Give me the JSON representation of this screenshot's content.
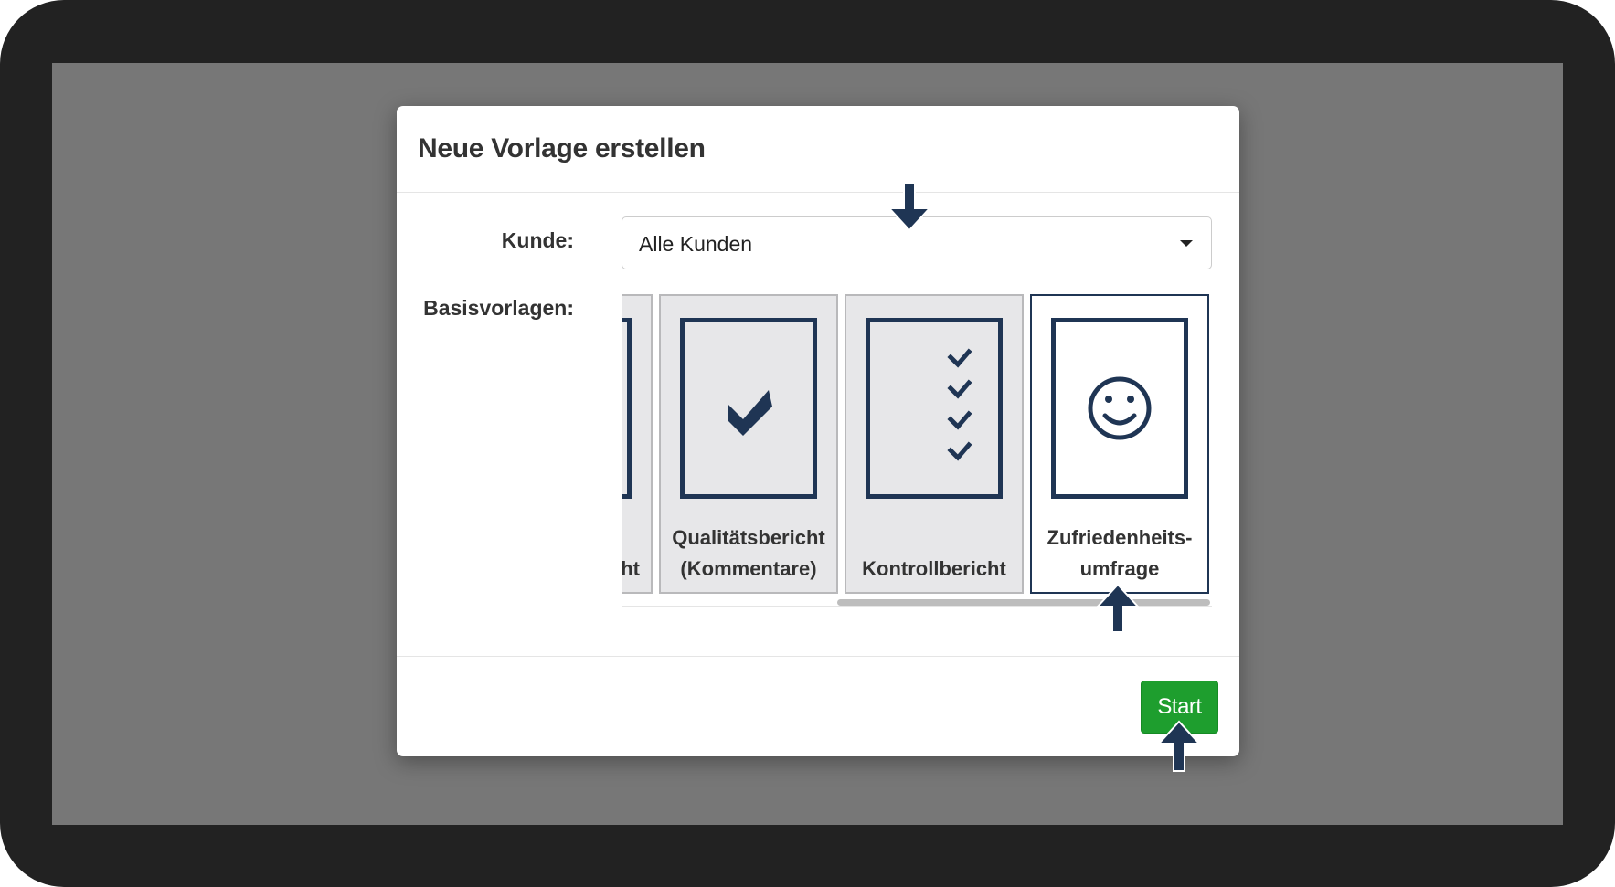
{
  "modal": {
    "title": "Neue Vorlage erstellen"
  },
  "form": {
    "customer_label": "Kunde:",
    "customer_value": "Alle Kunden",
    "templates_label": "Basisvorlagen:"
  },
  "templates": [
    {
      "label": "ht",
      "icon": "document-icon",
      "selected": false
    },
    {
      "label": "Qualitätsbericht\n(Kommentare)",
      "icon": "checkmark-icon",
      "selected": false
    },
    {
      "label": "Kontrollbericht",
      "icon": "checklist-icon",
      "selected": false
    },
    {
      "label": "Zufriedenheits-\numfrage",
      "icon": "smiley-icon",
      "selected": true
    }
  ],
  "footer": {
    "start_label": "Start"
  },
  "colors": {
    "primary_navy": "#1f3554",
    "start_green": "#1e9e2e",
    "selected_border": "#1f3554",
    "card_background": "#e7e7e9"
  },
  "annotations": [
    {
      "icon": "arrow-down-icon",
      "target": "customer-select"
    },
    {
      "icon": "arrow-up-icon",
      "target": "template-card-satisfaction"
    },
    {
      "icon": "arrow-up-icon",
      "target": "start-button"
    }
  ]
}
